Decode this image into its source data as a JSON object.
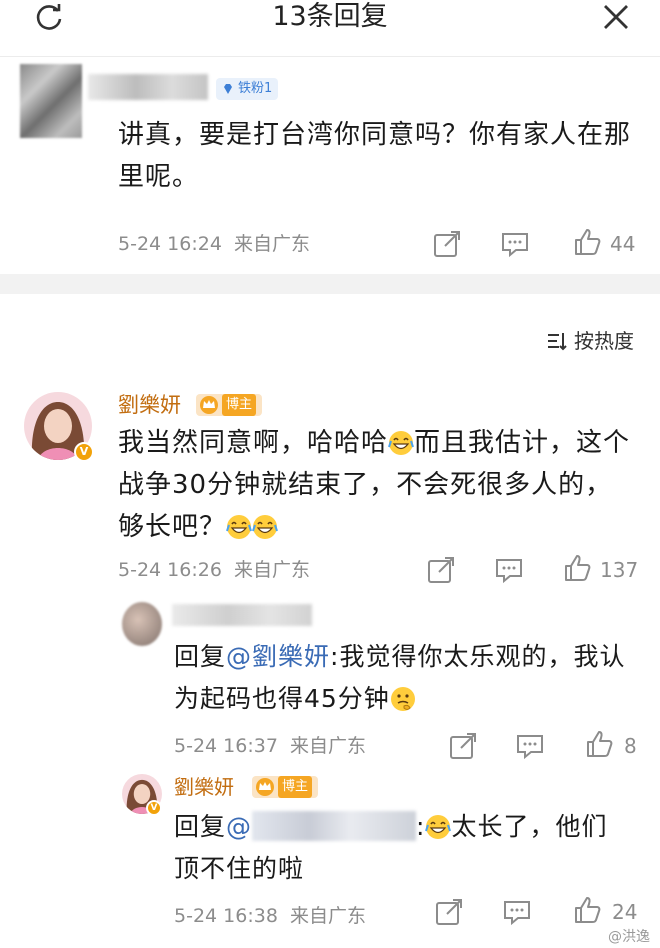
{
  "header": {
    "title": "13条回复"
  },
  "original": {
    "badge": "铁粉1",
    "text": "讲真，要是打台湾你同意吗？你有家人在那里呢。",
    "time": "5-24 16:24",
    "location": "来自广东",
    "likes": "44"
  },
  "sort": {
    "label": "按热度"
  },
  "main_comment": {
    "name": "劉樂妍",
    "badge": "博主",
    "text_1": "我当然同意啊，哈哈哈",
    "text_2": "而且我估计，这个战争30分钟就结束了，不会死很多人的，够长吧？",
    "time": "5-24 16:26",
    "location": "来自广东",
    "likes": "137"
  },
  "reply_1": {
    "prefix": "回复",
    "mention": "@劉樂妍",
    "text": ":我觉得你太乐观的，我认为起码也得45分钟",
    "time": "5-24 16:37",
    "location": "来自广东",
    "likes": "8"
  },
  "reply_2": {
    "name": "劉樂妍",
    "badge": "博主",
    "prefix": "回复",
    "mention": "@",
    "text": "太长了，他们顶不住的啦",
    "time": "5-24 16:38",
    "location": "来自广东",
    "likes": "24"
  },
  "watermark": "@洪逸",
  "colors": {
    "name": "#c26d10",
    "mention": "#3a6bb5",
    "meta": "#8c8c8c",
    "badge_bg": "#f5a623"
  }
}
